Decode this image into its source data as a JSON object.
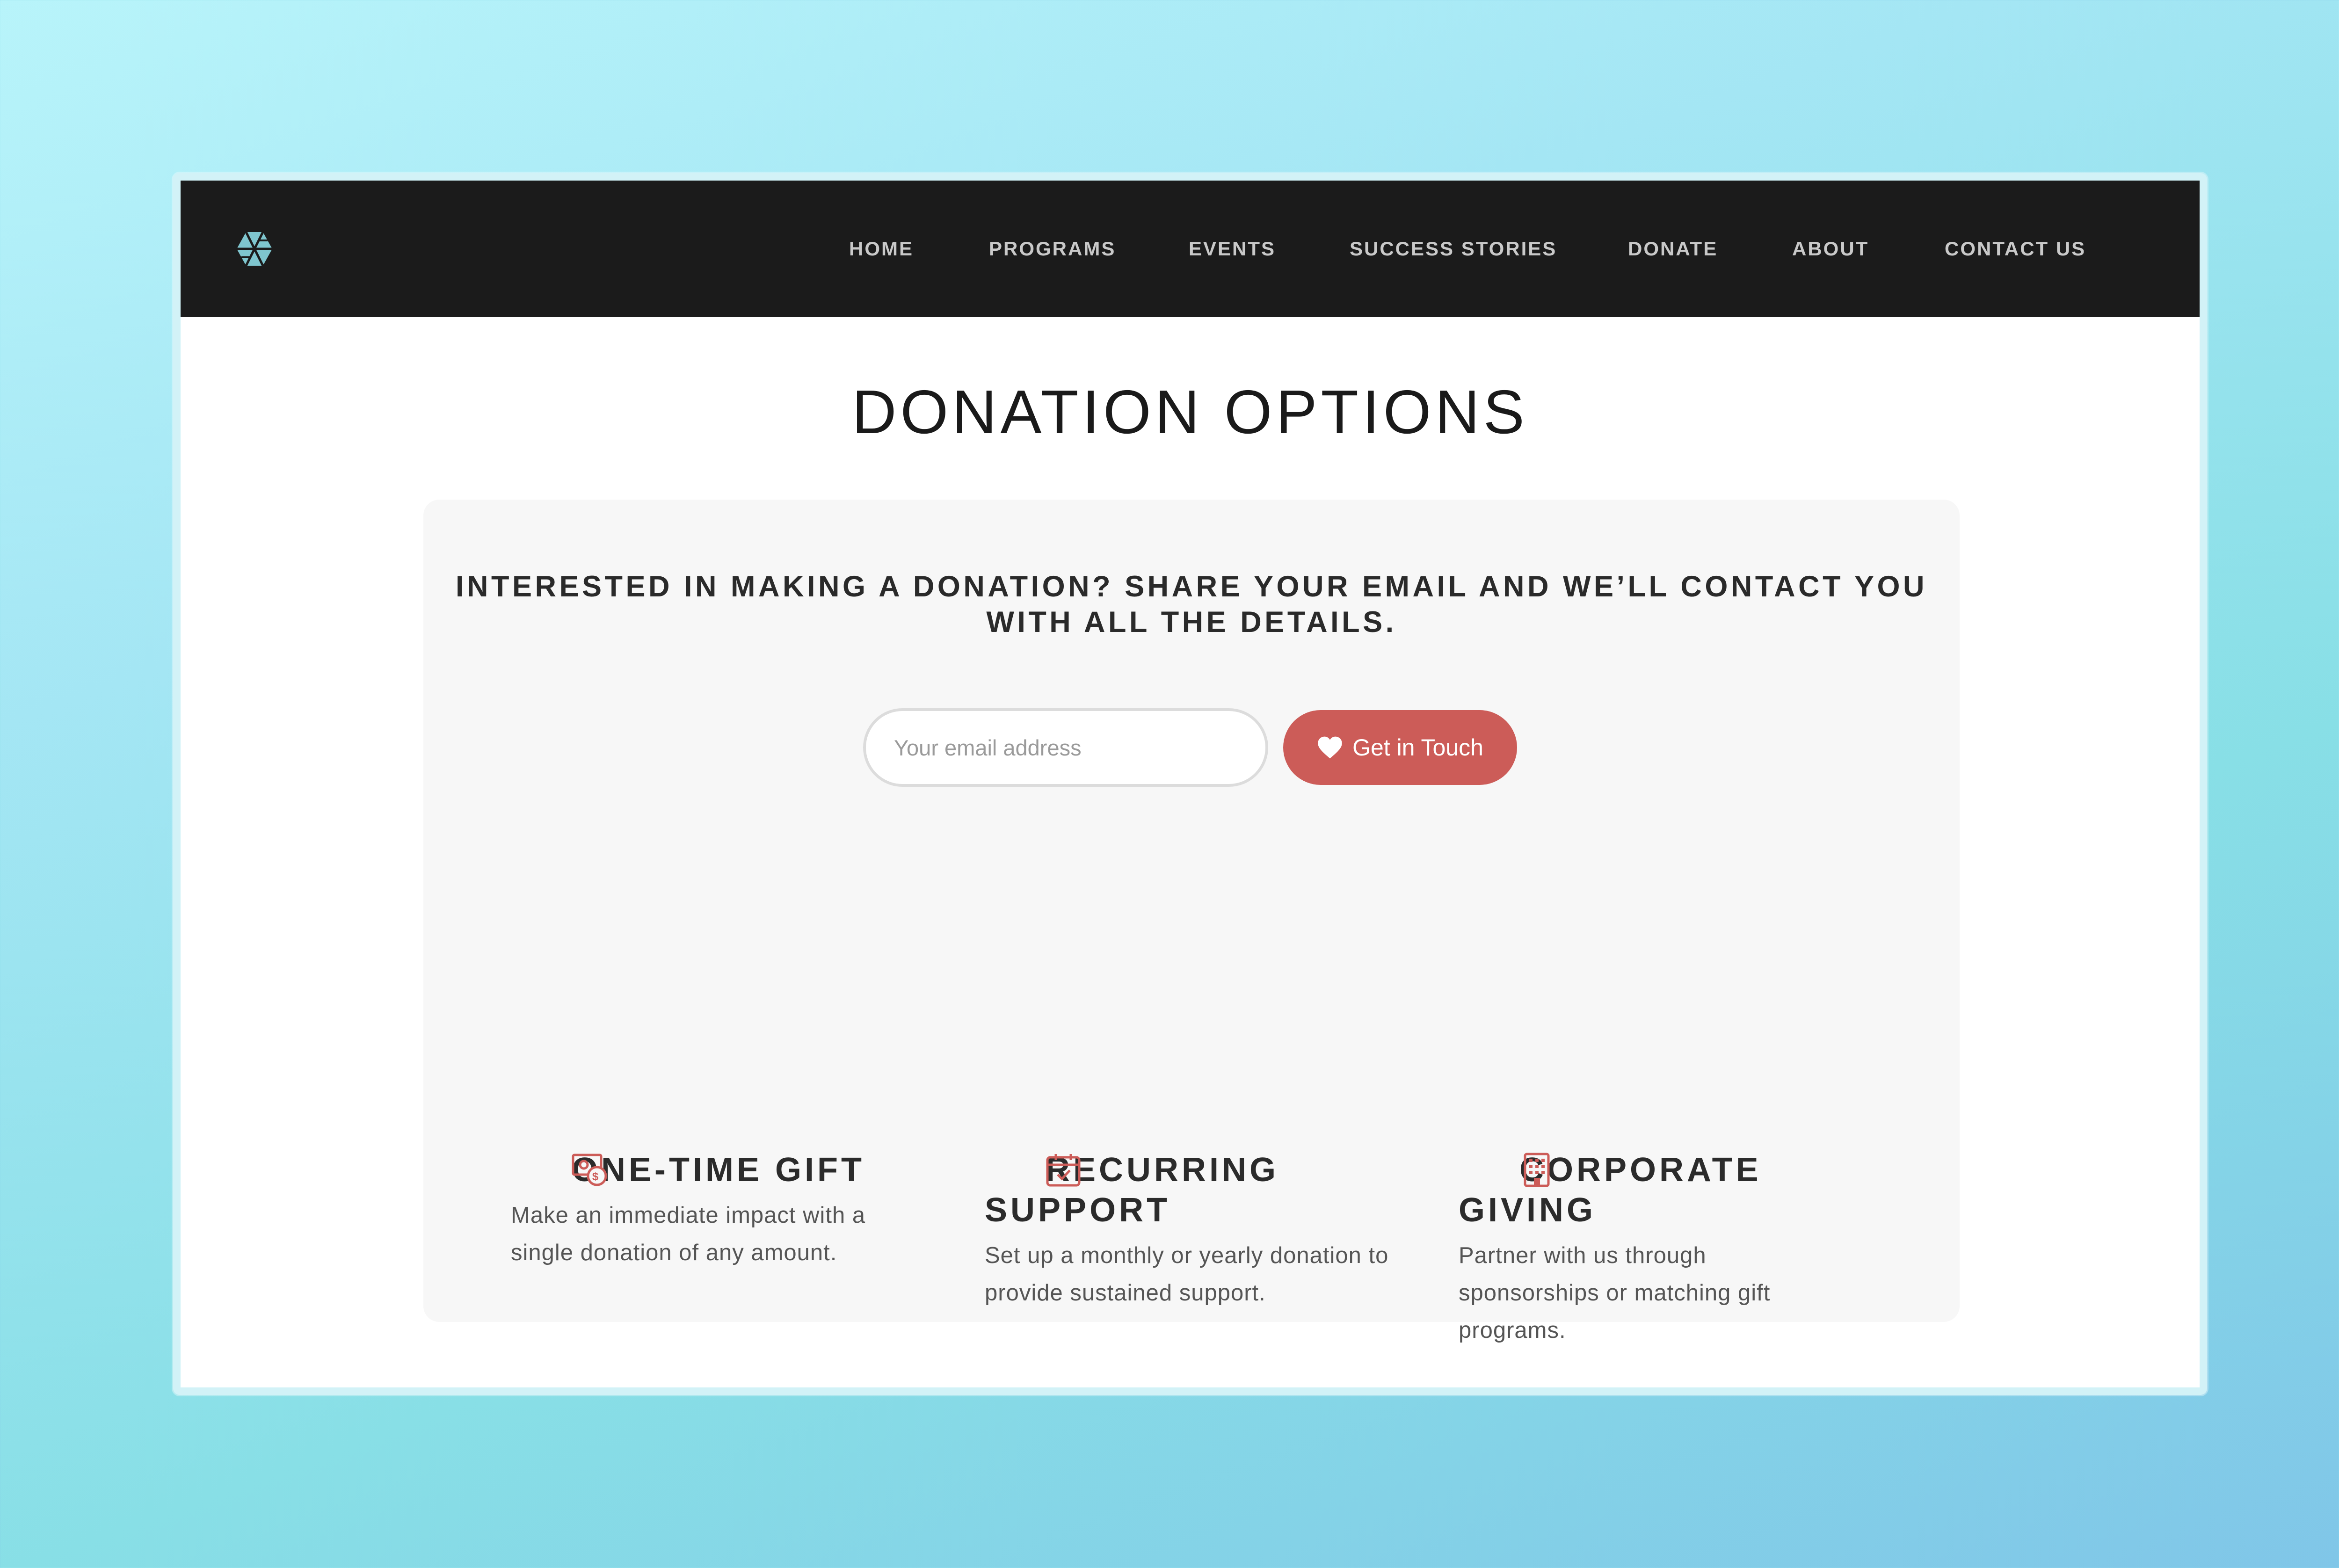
{
  "nav": {
    "logo_icon": "geometric-logo-icon",
    "links": [
      "HOME",
      "PROGRAMS",
      "EVENTS",
      "SUCCESS STORIES",
      "DONATE",
      "ABOUT",
      "CONTACT US"
    ]
  },
  "page": {
    "title": "DONATION OPTIONS"
  },
  "signup": {
    "heading": "INTERESTED IN MAKING A DONATION? SHARE YOUR EMAIL AND WE’LL CONTACT YOU WITH ALL THE DETAILS.",
    "email_placeholder": "Your email address",
    "email_value": "",
    "button_label": "Get in Touch",
    "button_icon": "heart-icon"
  },
  "options": [
    {
      "icon": "money-coin-icon",
      "title": "ONE-TIME GIFT",
      "description": "Make an immediate impact with a single donation of any amount."
    },
    {
      "icon": "calendar-check-icon",
      "title": "RECURRING SUPPORT",
      "description": "Set up a monthly or yearly donation to provide sustained support."
    },
    {
      "icon": "building-icon",
      "title": "CORPORATE GIVING",
      "description": "Partner with us through sponsorships or matching gift programs."
    }
  ],
  "colors": {
    "navbar": "#1b1b1b",
    "nav_text": "#c9c9c9",
    "accent": "#cc5c58",
    "logo": "#7fc6cf",
    "card_bg": "#f7f7f7"
  }
}
